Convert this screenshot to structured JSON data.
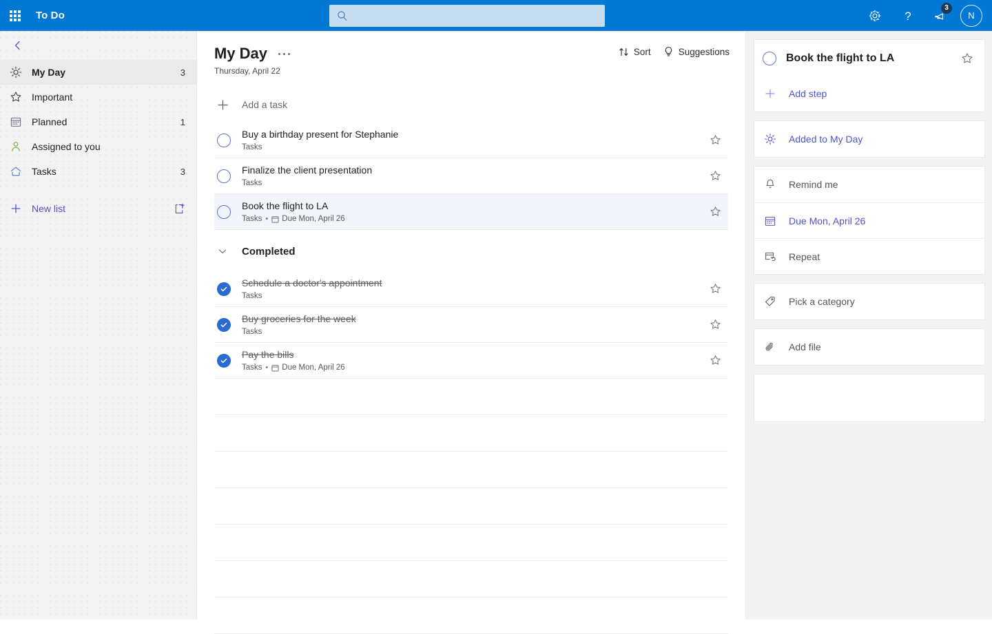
{
  "topbar": {
    "waffle_name": "app-launcher",
    "app_title": "To Do",
    "search_placeholder": "",
    "search_value": "",
    "settings_label": "Settings",
    "help_label": "Help",
    "feedback_label": "Feedback",
    "feedback_badge": "3",
    "avatar_initial": "N",
    "accent_color": "#0078d4",
    "search_bg": "#c7ddf2"
  },
  "sidebar": {
    "collapse_label": "Collapse",
    "items": [
      {
        "label": "My Day",
        "count": "3",
        "icon": "sun-icon",
        "active": true
      },
      {
        "label": "Important",
        "count": "",
        "icon": "star-icon",
        "active": false
      },
      {
        "label": "Planned",
        "count": "1",
        "icon": "calendar-icon",
        "active": false
      },
      {
        "label": "Assigned to you",
        "count": "",
        "icon": "person-icon",
        "active": false
      },
      {
        "label": "Tasks",
        "count": "3",
        "icon": "home-icon",
        "active": false
      }
    ],
    "new_list_label": "New list",
    "new_group_label": "New group"
  },
  "main": {
    "title": "My Day",
    "subtitle": "Thursday, April 22",
    "more_label": "More options",
    "sort_label": "Sort",
    "suggestions_label": "Suggestions",
    "add_task_placeholder": "Add a task",
    "add_task_value": "",
    "completed_label": "Completed",
    "tasks": [
      {
        "title": "Buy a birthday present for Stephanie",
        "list": "Tasks",
        "due": "",
        "done": false,
        "selected": false
      },
      {
        "title": "Finalize the client presentation",
        "list": "Tasks",
        "due": "",
        "done": false,
        "selected": false
      },
      {
        "title": "Book the flight to LA",
        "list": "Tasks",
        "due": "Due Mon, April 26",
        "done": false,
        "selected": true
      }
    ],
    "completed_tasks": [
      {
        "title": "Schedule a doctor's appointment",
        "list": "Tasks",
        "due": "",
        "done": true
      },
      {
        "title": "Buy groceries for the week",
        "list": "Tasks",
        "due": "",
        "done": true
      },
      {
        "title": "Pay the bills",
        "list": "Tasks",
        "due": "Due Mon, April 26",
        "done": true
      }
    ],
    "empty_rows": 7
  },
  "detail": {
    "task_title": "Book the flight to LA",
    "add_step_label": "Add step",
    "added_to_my_day_label": "Added to My Day",
    "remind_me_label": "Remind me",
    "due_date_label": "Due Mon, April 26",
    "repeat_label": "Repeat",
    "category_label": "Pick a category",
    "add_file_label": "Add file",
    "notes_placeholder": "",
    "notes_value": ""
  }
}
